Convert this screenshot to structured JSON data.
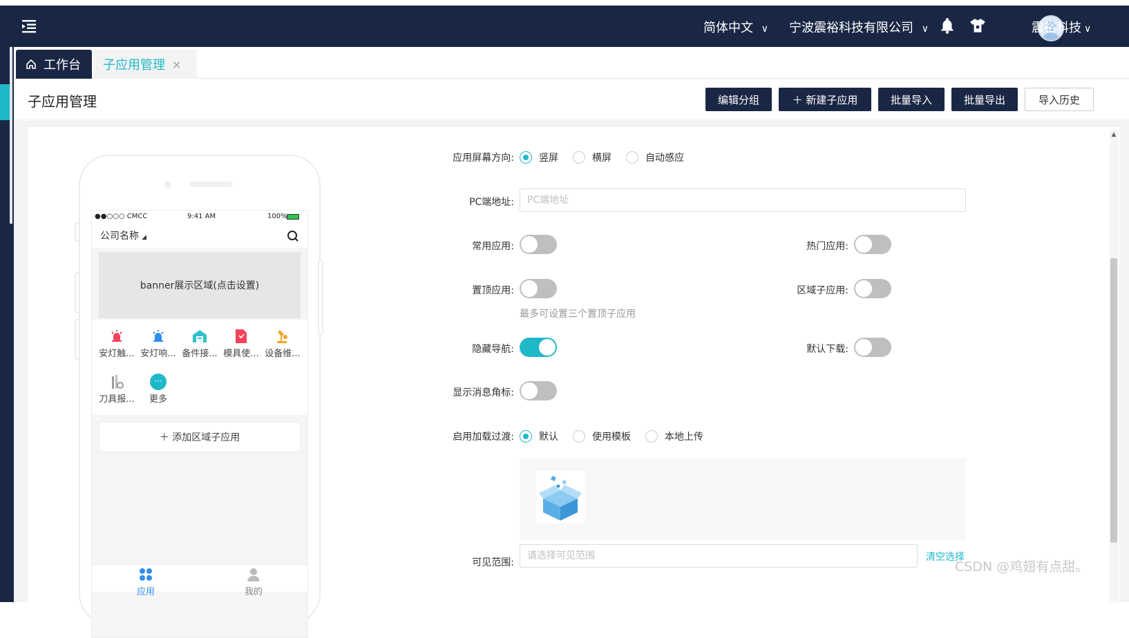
{
  "header": {
    "language": "简体中文",
    "company": "宁波震裕科技有限公司",
    "user_name": "震裕科技",
    "colors": {
      "bg": "#1a2744",
      "accent": "#1fb8c9"
    }
  },
  "tabs": [
    {
      "label": "工作台",
      "icon": "home-icon",
      "active": false
    },
    {
      "label": "子应用管理",
      "active": true,
      "closable": true
    }
  ],
  "page": {
    "title": "子应用管理",
    "buttons": {
      "edit_group": "编辑分组",
      "new_subapp": "＋ 新建子应用",
      "batch_import": "批量导入",
      "batch_export": "批量导出",
      "import_history": "导入历史"
    }
  },
  "phone": {
    "status": {
      "carrier": "●●○○○ CMCC",
      "time": "9:41 AM",
      "battery": "100%"
    },
    "company_name": "公司名称",
    "banner": "banner展示区域(点击设置)",
    "apps": [
      {
        "label": "安灯触...",
        "icon": "alarm-red-icon"
      },
      {
        "label": "安灯响...",
        "icon": "alarm-blue-icon"
      },
      {
        "label": "备件接...",
        "icon": "warehouse-icon"
      },
      {
        "label": "模具使...",
        "icon": "document-icon"
      },
      {
        "label": "设备维...",
        "icon": "robot-arm-icon"
      },
      {
        "label": "刀具报...",
        "icon": "tool-icon"
      },
      {
        "label": "更多",
        "icon": "more-icon"
      }
    ],
    "add_region": "＋ 添加区域子应用",
    "nav": {
      "apps": "应用",
      "mine": "我的"
    }
  },
  "form": {
    "orientation": {
      "label": "应用屏幕方向:",
      "options": [
        "竖屏",
        "横屏",
        "自动感应"
      ],
      "selected": "竖屏"
    },
    "pc_url": {
      "label": "PC端地址:",
      "placeholder": "PC端地址",
      "value": ""
    },
    "common_app": {
      "label": "常用应用:",
      "on": false
    },
    "hot_app": {
      "label": "热门应用:",
      "on": false
    },
    "pin_top": {
      "label": "置顶应用:",
      "on": false,
      "hint": "最多可设置三个置顶子应用"
    },
    "region_app": {
      "label": "区域子应用:",
      "on": false
    },
    "hide_nav": {
      "label": "隐藏导航:",
      "on": true
    },
    "default_download": {
      "label": "默认下载:",
      "on": false
    },
    "badge": {
      "label": "显示消息角标:",
      "on": false
    },
    "loading": {
      "label": "启用加载过渡:",
      "options": [
        "默认",
        "使用模板",
        "本地上传"
      ],
      "selected": "默认"
    },
    "visible_scope": {
      "label": "可见范围:",
      "placeholder": "请选择可见范围",
      "clear": "清空选择"
    }
  },
  "watermark": "CSDN @鸡翅有点甜。"
}
